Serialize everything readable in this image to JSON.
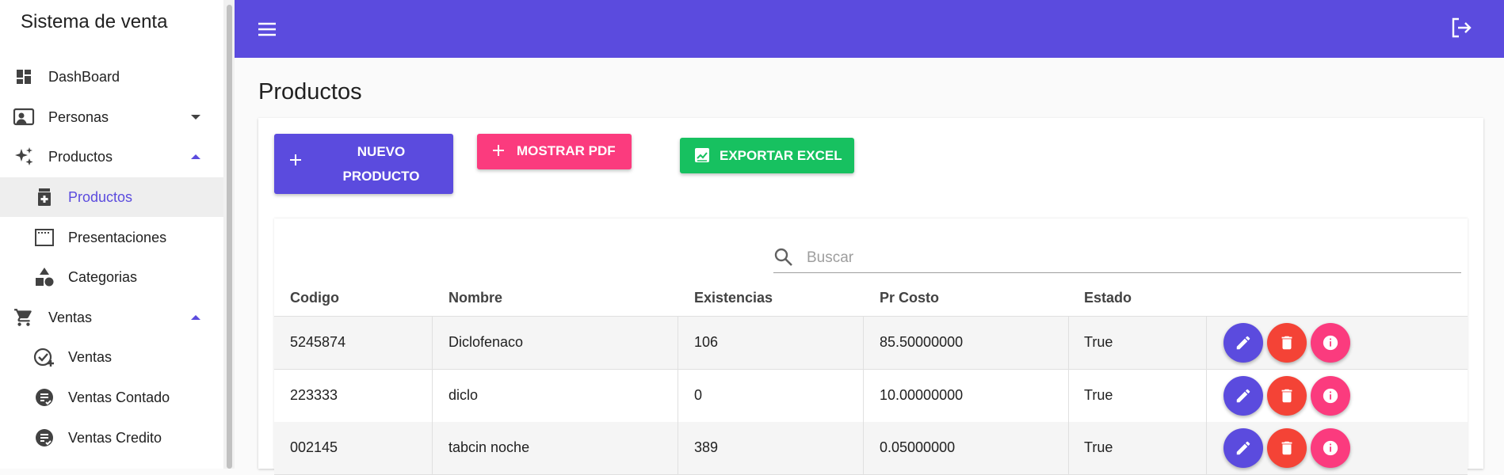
{
  "sidebar": {
    "title": "Sistema de venta",
    "items": [
      {
        "label": "DashBoard",
        "icon": "dashboard-icon"
      },
      {
        "label": "Personas",
        "icon": "person-card-icon"
      },
      {
        "label": "Productos",
        "icon": "sparkle-icon"
      },
      {
        "label": "Productos",
        "icon": "medicine-box-icon"
      },
      {
        "label": "Presentaciones",
        "icon": "frame-icon"
      },
      {
        "label": "Categorias",
        "icon": "shapes-icon"
      },
      {
        "label": "Ventas",
        "icon": "cart-icon"
      },
      {
        "label": "Ventas",
        "icon": "check-plus-icon"
      },
      {
        "label": "Ventas Contado",
        "icon": "receipt-icon"
      },
      {
        "label": "Ventas Credito",
        "icon": "receipt-icon"
      }
    ]
  },
  "page": {
    "title": "Productos"
  },
  "toolbar": {
    "nuevo_line1": "NUEVO",
    "nuevo_line2": "PRODUCTO",
    "pdf_label": "MOSTRAR PDF",
    "excel_label": "EXPORTAR EXCEL"
  },
  "search": {
    "placeholder": "Buscar"
  },
  "table": {
    "columns": [
      "Codigo",
      "Nombre",
      "Existencias",
      "Pr Costo",
      "Estado"
    ],
    "rows": [
      [
        "5245874",
        "Diclofenaco",
        "106",
        "85.50000000",
        "True"
      ],
      [
        "223333",
        "diclo",
        "0",
        "10.00000000",
        "True"
      ],
      [
        "002145",
        "tabcin noche",
        "389",
        "0.05000000",
        "True"
      ]
    ]
  },
  "colors": {
    "primary": "#5b4bde",
    "pink": "#fb3b7e",
    "green": "#17c160",
    "red": "#f44336"
  }
}
